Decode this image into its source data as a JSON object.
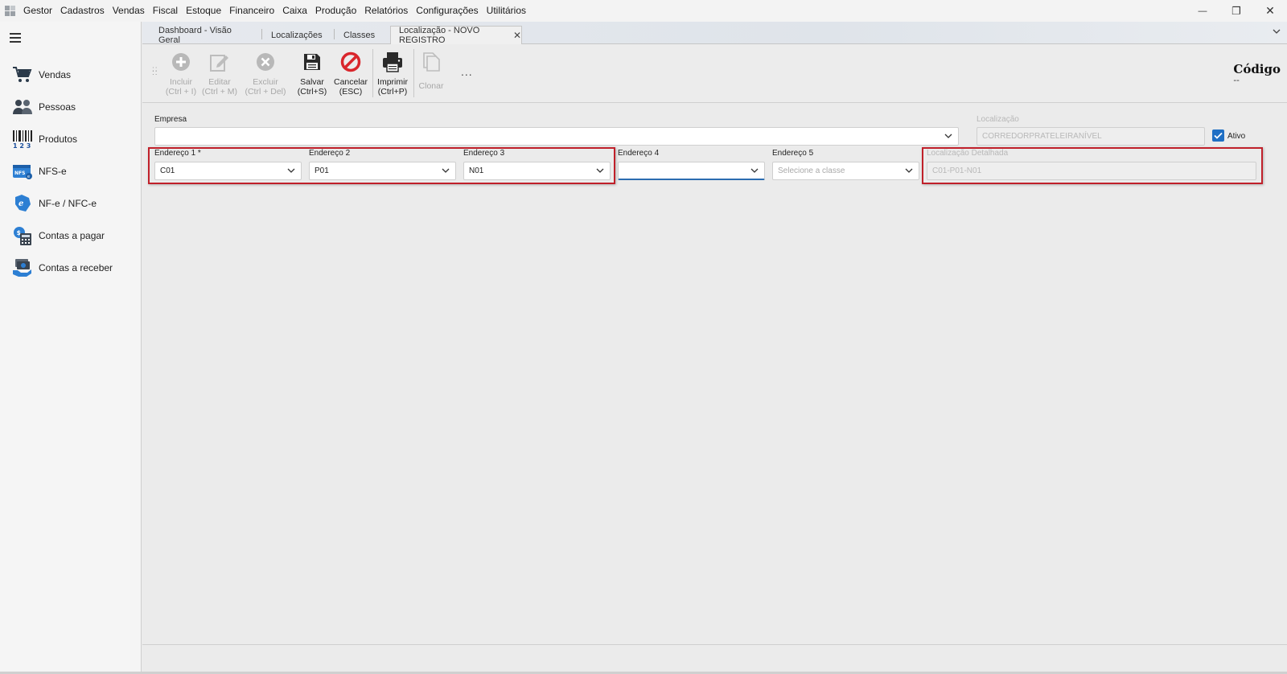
{
  "menu": [
    "Gestor",
    "Cadastros",
    "Vendas",
    "Fiscal",
    "Estoque",
    "Financeiro",
    "Caixa",
    "Produção",
    "Relatórios",
    "Configurações",
    "Utilitários"
  ],
  "window_controls": {
    "minimize": "—",
    "restore": "❐",
    "close": "✕"
  },
  "sidebar": {
    "items": [
      {
        "label": "Vendas",
        "icon": "cart-icon"
      },
      {
        "label": "Pessoas",
        "icon": "people-icon"
      },
      {
        "label": "Produtos",
        "icon": "barcode-icon"
      },
      {
        "label": "NFS-e",
        "icon": "nfse-icon"
      },
      {
        "label": "NF-e / NFC-e",
        "icon": "nfe-icon"
      },
      {
        "label": "Contas a pagar",
        "icon": "calculator-icon"
      },
      {
        "label": "Contas a receber",
        "icon": "money-icon"
      }
    ]
  },
  "tabs": [
    {
      "label": "Dashboard - Visão Geral"
    },
    {
      "label": "Localizações"
    },
    {
      "label": "Classes"
    },
    {
      "label": "Localização - NOVO REGISTRO",
      "active": true
    }
  ],
  "toolbar": {
    "incluir": {
      "label": "Incluir",
      "shortcut": "(Ctrl + I)"
    },
    "editar": {
      "label": "Editar",
      "shortcut": "(Ctrl + M)"
    },
    "excluir": {
      "label": "Excluir",
      "shortcut": "(Ctrl + Del)"
    },
    "salvar": {
      "label": "Salvar",
      "shortcut": "(Ctrl+S)"
    },
    "cancelar": {
      "label": "Cancelar",
      "shortcut": "(ESC)"
    },
    "imprimir": {
      "label": "Imprimir",
      "shortcut": "(Ctrl+P)"
    },
    "clonar": {
      "label": "Clonar"
    },
    "more": "...",
    "codigo_title": "Código",
    "codigo_value": "--"
  },
  "form": {
    "empresa": {
      "label": "Empresa",
      "value": ""
    },
    "localizacao": {
      "label": "Localização",
      "value": "CORREDORPRATELEIRANÍVEL"
    },
    "ativo": {
      "label": "Ativo",
      "checked": true
    },
    "endereco1": {
      "label": "Endereço 1 *",
      "value": "C01"
    },
    "endereco2": {
      "label": "Endereço 2",
      "value": "P01"
    },
    "endereco3": {
      "label": "Endereço 3",
      "value": "N01"
    },
    "endereco4": {
      "label": "Endereço 4",
      "value": ""
    },
    "endereco5": {
      "label": "Endereço 5",
      "placeholder": "Selecione a classe"
    },
    "localizacao_detalhada": {
      "label": "Localização Detalhada",
      "value": "C01-P01-N01"
    }
  },
  "colors": {
    "accent": "#1f6fc4",
    "highlight": "#c0202a",
    "cancel": "#d9262c"
  }
}
